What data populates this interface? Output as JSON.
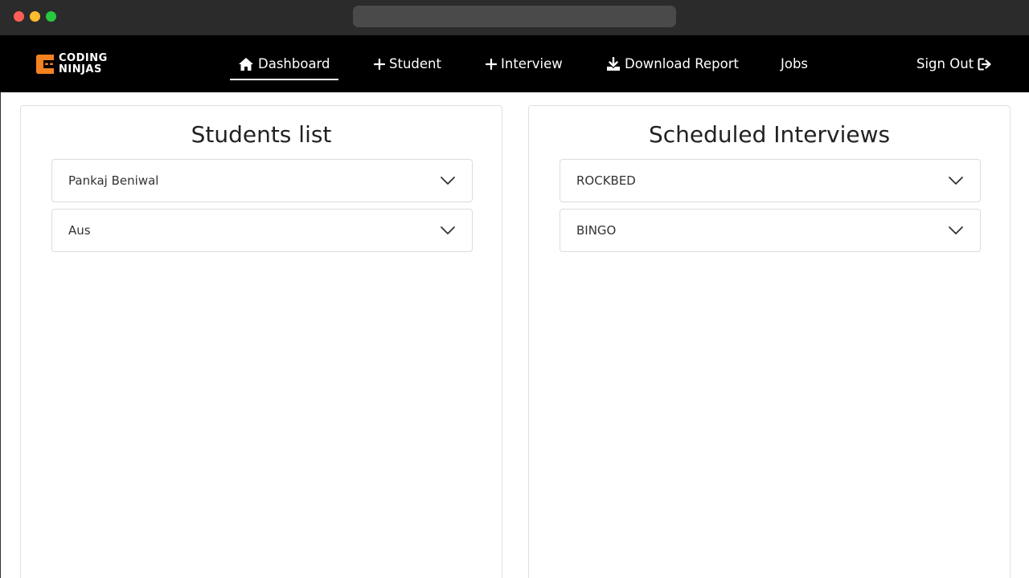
{
  "brand": {
    "logo_line1": "CODING",
    "logo_line2": "NINJAS",
    "accent": "#f58220"
  },
  "nav": {
    "dashboard": "Dashboard",
    "student": "Student",
    "interview": "Interview",
    "download_report": "Download Report",
    "jobs": "Jobs",
    "sign_out": "Sign Out"
  },
  "students_panel": {
    "title": "Students list",
    "items": [
      {
        "label": "Pankaj Beniwal"
      },
      {
        "label": "Aus"
      }
    ]
  },
  "interviews_panel": {
    "title": "Scheduled Interviews",
    "items": [
      {
        "label": "ROCKBED"
      },
      {
        "label": "BINGO"
      }
    ]
  },
  "icons": {
    "home": "home-icon",
    "plus": "plus-icon",
    "download": "download-icon",
    "sign_out": "sign-out-icon",
    "chevron": "chevron-down-icon"
  }
}
